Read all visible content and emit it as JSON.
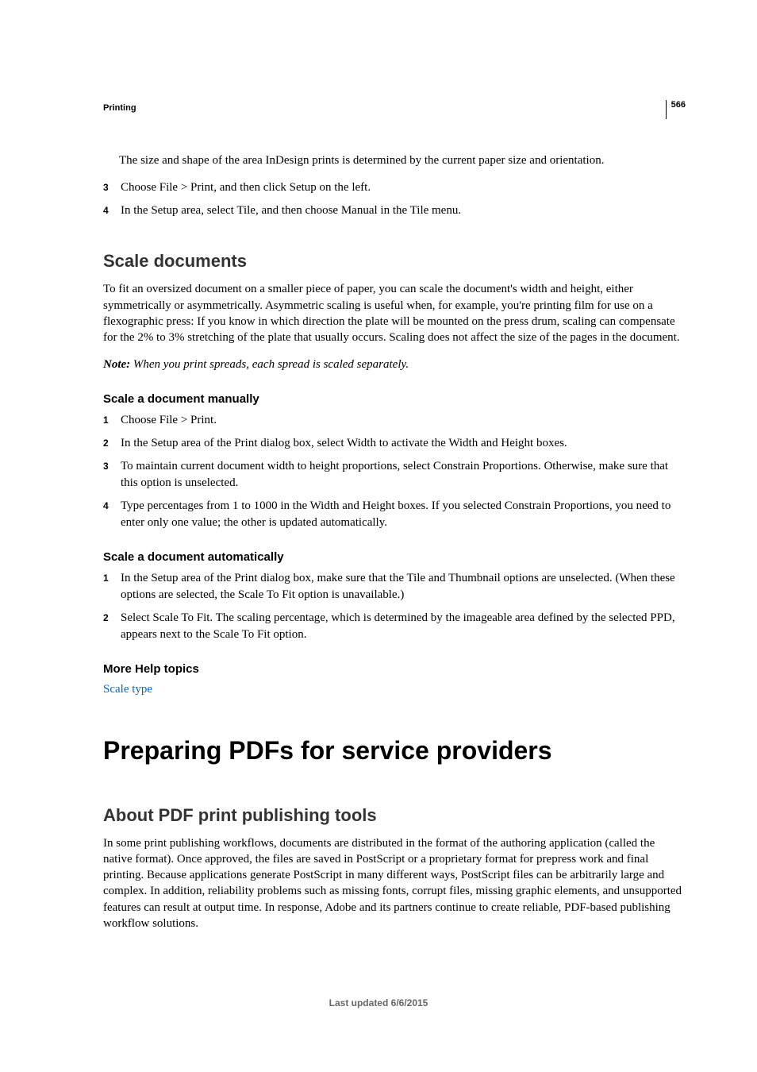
{
  "header": {
    "section": "Printing",
    "pageNumber": "566"
  },
  "intro": {
    "lead": "The size and shape of the area InDesign prints is determined by the current paper size and orientation.",
    "steps": [
      {
        "n": "3",
        "text": "Choose File > Print, and then click Setup on the left."
      },
      {
        "n": "4",
        "text": "In the Setup area, select Tile, and then choose Manual in the Tile menu."
      }
    ]
  },
  "scaleDocs": {
    "title": "Scale documents",
    "para": "To fit an oversized document on a smaller piece of paper, you can scale the document's width and height, either symmetrically or asymmetrically. Asymmetric scaling is useful when, for example, you're printing film for use on a flexographic press: If you know in which direction the plate will be mounted on the press drum, scaling can compensate for the 2% to 3% stretching of the plate that usually occurs. Scaling does not affect the size of the pages in the document.",
    "noteLabel": "Note:",
    "noteText": " When you print spreads, each spread is scaled separately."
  },
  "manual": {
    "title": "Scale a document manually",
    "steps": [
      {
        "n": "1",
        "text": "Choose File > Print."
      },
      {
        "n": "2",
        "text": "In the Setup area of the Print dialog box, select Width to activate the Width and Height boxes."
      },
      {
        "n": "3",
        "text": "To maintain current document width to height proportions, select Constrain Proportions. Otherwise, make sure that this option is unselected."
      },
      {
        "n": "4",
        "text": "Type percentages from 1 to 1000 in the Width and Height boxes. If you selected Constrain Proportions, you need to enter only one value; the other is updated automatically."
      }
    ]
  },
  "auto": {
    "title": "Scale a document automatically",
    "steps": [
      {
        "n": "1",
        "text": "In the Setup area of the Print dialog box, make sure that the Tile and Thumbnail options are unselected. (When these options are selected, the Scale To Fit option is unavailable.)"
      },
      {
        "n": "2",
        "text": "Select Scale To Fit. The scaling percentage, which is determined by the imageable area defined by the selected PPD, appears next to the Scale To Fit option."
      }
    ]
  },
  "moreHelp": {
    "title": "More Help topics",
    "link": "Scale type"
  },
  "pdfSection": {
    "h1": "Preparing PDFs for service providers",
    "h2": "About PDF print publishing tools",
    "para": "In some print publishing workflows, documents are distributed in the format of the authoring application (called the native format). Once approved, the files are saved in PostScript or a proprietary format for prepress work and final printing. Because applications generate PostScript in many different ways, PostScript files can be arbitrarily large and complex. In addition, reliability problems such as missing fonts, corrupt files, missing graphic elements, and unsupported features can result at output time. In response, Adobe and its partners continue to create reliable, PDF-based publishing workflow solutions."
  },
  "footer": {
    "text": "Last updated 6/6/2015"
  }
}
